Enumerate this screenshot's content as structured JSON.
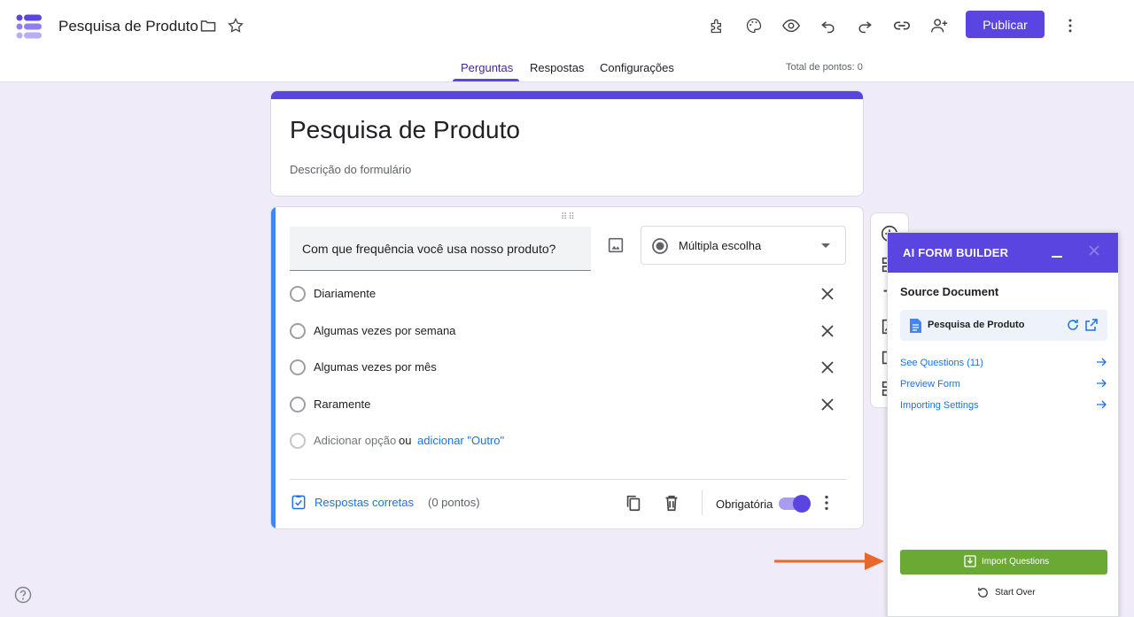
{
  "header": {
    "title": "Pesquisa de Produto",
    "publish_label": "Publicar",
    "icons": [
      "folder-icon",
      "star-icon",
      "addon-icon",
      "palette-icon",
      "preview-icon",
      "undo-icon",
      "redo-icon",
      "link-icon",
      "add-collaborator-icon",
      "more-vert-icon"
    ]
  },
  "tabs": {
    "questions": "Perguntas",
    "responses": "Respostas",
    "settings": "Configurações",
    "points": "Total de pontos: 0"
  },
  "form": {
    "title": "Pesquisa de Produto",
    "description": "Descrição do formulário"
  },
  "question": {
    "text": "Com que frequência você usa nosso produto?",
    "type": "Múltipla escolha",
    "options": [
      "Diariamente",
      "Algumas vezes por semana",
      "Algumas vezes por mês",
      "Raramente"
    ],
    "add_option": "Adicionar opção",
    "or": "ou",
    "add_other": "adicionar \"Outro\"",
    "answers_label": "Respostas corretas",
    "answers_points": "(0 pontos)",
    "required_label": "Obrigatória"
  },
  "ai_panel": {
    "title": "AI FORM BUILDER",
    "source_heading": "Source Document",
    "source_name": "Pesquisa de Produto",
    "links": [
      "See Questions (11)",
      "Preview Form",
      "Importing Settings"
    ],
    "import_label": "Import Questions",
    "start_over_label": "Start Over"
  },
  "colors": {
    "accent": "#5b45e0",
    "import_green": "#6aaa34",
    "arrow_orange": "#e8682b",
    "link_blue": "#1a73e8"
  }
}
